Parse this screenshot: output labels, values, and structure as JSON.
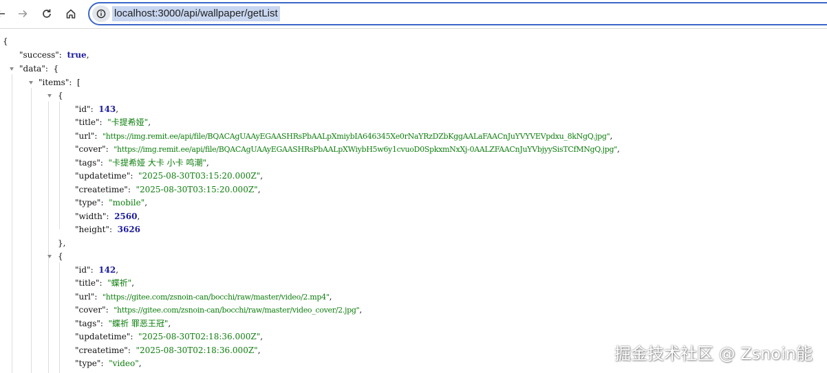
{
  "browser": {
    "address_url": "localhost:3000/api/wallpaper/getList"
  },
  "json_view": {
    "root_open": "{",
    "success": {
      "key": "\"success\"",
      "value": "true"
    },
    "data_key": "\"data\"",
    "data_open": "{",
    "items_key": "\"items\"",
    "items_open": "[",
    "item_open": "{",
    "item_close": "},",
    "item1": {
      "id": {
        "key": "\"id\"",
        "value": "143"
      },
      "title": {
        "key": "\"title\"",
        "value": "\"卡提希娅\""
      },
      "url": {
        "key": "\"url\"",
        "value": "\"https://img.remit.ee/api/file/BQACAgUAAyEGAASHRsPbAALpXmiybIA646345Xe0rNaYRzDZbKggAALaFAACnJuYVYVEVpdxu_8kNgQ.jpg\""
      },
      "cover": {
        "key": "\"cover\"",
        "value": "\"https://img.remit.ee/api/file/BQACAgUAAyEGAASHRsPbAALpXWiybH5w6y1cvuoD0SpkxmNxXj-0AALZFAACnJuYVbjyySisTCfMNgQ.jpg\""
      },
      "tags": {
        "key": "\"tags\"",
        "value": "\"卡提希娅 大卡 小卡 鸣潮\""
      },
      "updatetime": {
        "key": "\"updatetime\"",
        "value": "\"2025-08-30T03:15:20.000Z\""
      },
      "createtime": {
        "key": "\"createtime\"",
        "value": "\"2025-08-30T03:15:20.000Z\""
      },
      "type": {
        "key": "\"type\"",
        "value": "\"mobile\""
      },
      "width": {
        "key": "\"width\"",
        "value": "2560"
      },
      "height": {
        "key": "\"height\"",
        "value": "3626"
      }
    },
    "item2": {
      "id": {
        "key": "\"id\"",
        "value": "142"
      },
      "title": {
        "key": "\"title\"",
        "value": "\"蝶祈\""
      },
      "url": {
        "key": "\"url\"",
        "value": "\"https://gitee.com/zsnoin-can/bocchi/raw/master/video/2.mp4\""
      },
      "cover": {
        "key": "\"cover\"",
        "value": "\"https://gitee.com/zsnoin-can/bocchi/raw/master/video_cover/2.jpg\""
      },
      "tags": {
        "key": "\"tags\"",
        "value": "\"蝶祈 罪恶王冠\""
      },
      "updatetime": {
        "key": "\"updatetime\"",
        "value": "\"2025-08-30T02:18:36.000Z\""
      },
      "createtime": {
        "key": "\"createtime\"",
        "value": "\"2025-08-30T02:18:36.000Z\""
      },
      "type": {
        "key": "\"type\"",
        "value": "\"video\""
      }
    }
  },
  "watermark": "掘金技术社区 @ Zsnoin能",
  "icons": [
    "back-arrow-icon",
    "forward-arrow-icon",
    "reload-icon",
    "home-icon",
    "site-info-icon",
    "collapse-arrow-icon"
  ]
}
